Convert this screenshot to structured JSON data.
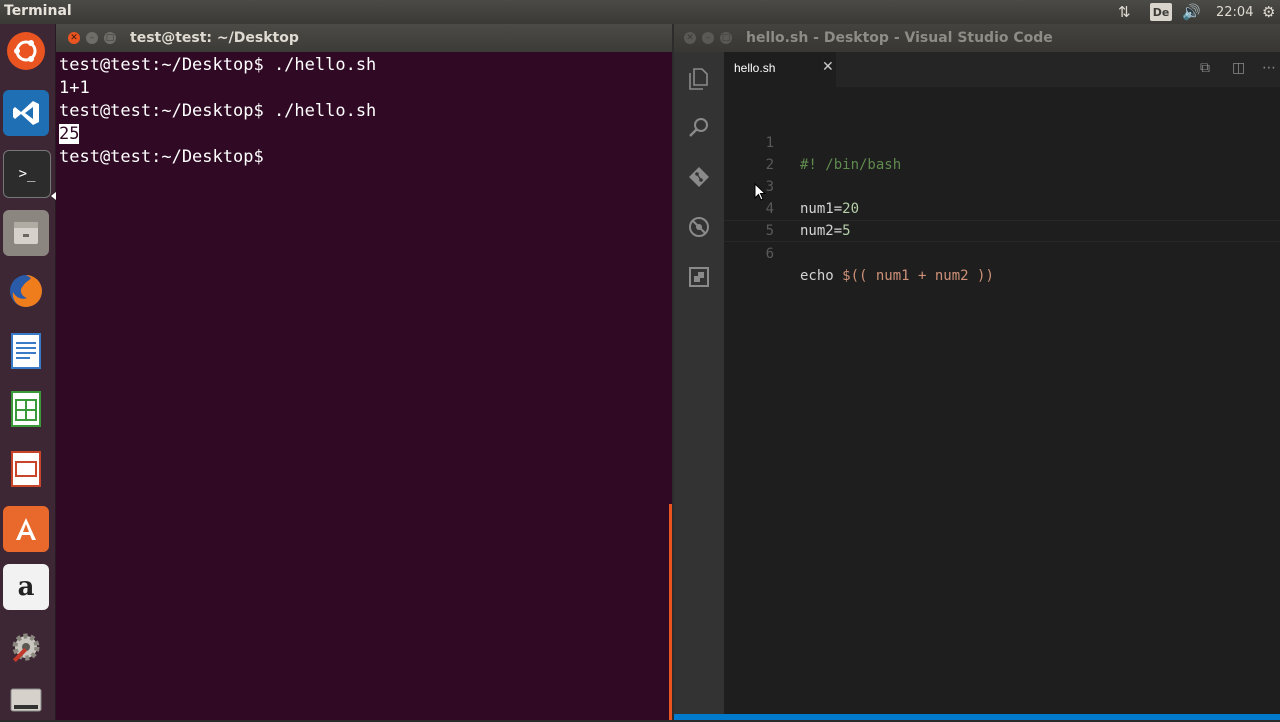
{
  "top_panel": {
    "app_title": "Terminal",
    "keyboard_layout": "De",
    "clock": "22:04"
  },
  "launcher": {
    "items": [
      "ubuntu-dash",
      "visual-studio-code",
      "terminal",
      "files",
      "firefox",
      "libreoffice-writer",
      "libreoffice-calc",
      "libreoffice-impress",
      "ubuntu-software",
      "amazon",
      "system-settings",
      "dvd"
    ]
  },
  "terminal": {
    "title": "test@test: ~/Desktop",
    "lines": [
      {
        "prompt": "test@test:~/Desktop$",
        "command": " ./hello.sh"
      },
      {
        "output": "1+1"
      },
      {
        "prompt": "test@test:~/Desktop$",
        "command": " ./hello.sh"
      },
      {
        "output_selected": "25"
      },
      {
        "prompt": "test@test:~/Desktop$",
        "command": ""
      }
    ]
  },
  "vscode": {
    "title": "hello.sh - Desktop - Visual Studio Code",
    "tab_label": "hello.sh",
    "line_numbers": [
      "1",
      "2",
      "3",
      "4",
      "5",
      "6"
    ],
    "code": {
      "line1": "#! /bin/bash",
      "line2": "",
      "line3_var": "num1=",
      "line3_val": "20",
      "line4_var": "num2=",
      "line4_val": "5",
      "line5": "",
      "line6_cmd": "echo ",
      "line6_expr": "$(( num1 + num2 ))"
    }
  },
  "colors": {
    "terminal_bg": "#300a24",
    "ubuntu_orange": "#e95420",
    "vscode_bg": "#1e1e1e",
    "vscode_statusbar": "#007acc"
  }
}
